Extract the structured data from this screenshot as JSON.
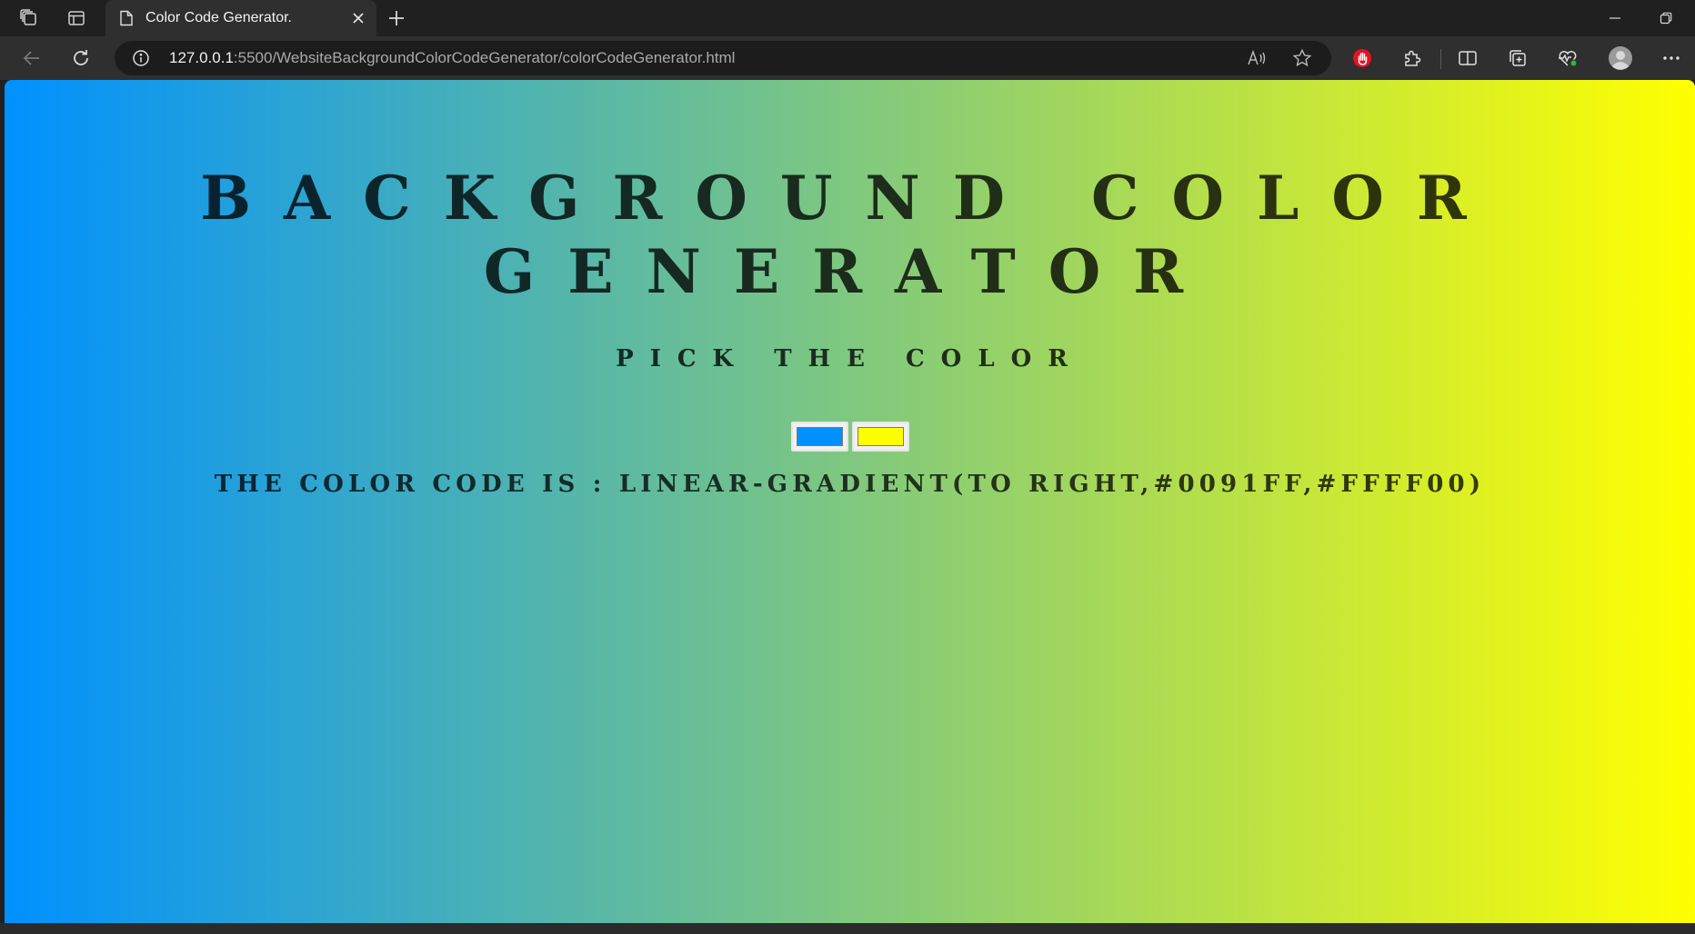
{
  "browser": {
    "tab": {
      "title": "Color Code Generator."
    },
    "address_bar": {
      "url_host": "127.0.0.1",
      "url_rest": ":5500/WebsiteBackgroundColorCodeGenerator/colorCodeGenerator.html"
    },
    "icons": {
      "workspaces": "workspaces-icon",
      "tab_actions": "tab-actions-icon",
      "page": "page-icon",
      "close": "close-icon",
      "new_tab": "plus-icon",
      "minimize": "minimize-icon",
      "restore": "restore-icon",
      "back": "back-arrow-icon",
      "refresh": "refresh-icon",
      "info": "info-icon",
      "read_aloud": "read-aloud-icon",
      "favorite": "star-icon",
      "extension_hand": "hand-stop-icon",
      "extensions": "puzzle-icon",
      "split_screen": "split-screen-icon",
      "collections": "collections-icon",
      "performance": "heartbeat-icon",
      "profile": "profile-icon",
      "more": "more-dots-icon"
    }
  },
  "page": {
    "title_line1": "BACKGROUND COLOR",
    "title_line2": "GENERATOR",
    "subtitle": "PICK THE COLOR",
    "color1": "#0091ff",
    "color2": "#ffff00",
    "code_label": "THE COLOR CODE IS : LINEAR-GRADIENT(TO RIGHT,#0091FF,#FFFF00)"
  }
}
